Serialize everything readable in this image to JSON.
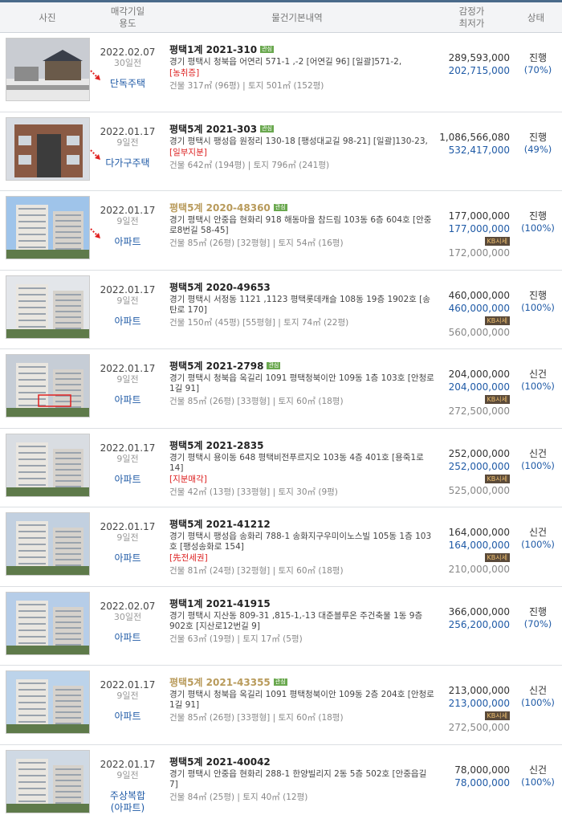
{
  "header": {
    "photo": "사진",
    "date_l1": "매각기일",
    "date_l2": "용도",
    "info": "물건기본내역",
    "price_l1": "감정가",
    "price_l2": "최저가",
    "status": "상태"
  },
  "rows": [
    {
      "date": "2022.02.07",
      "ago": "30일전",
      "usage": "단독주택",
      "usage2": "",
      "case": "평택1계 2021-310",
      "badge": "관심",
      "highlight": false,
      "addr": "경기 평택시 청북읍 어연리 571-1 ,-2 [어연길 96] [일괄]571-2,",
      "warn": "[농취증]",
      "area": "건물 317㎡ (96평)  |  토지 501㎡ (152평)",
      "appraisal": "289,593,000",
      "minimum": "202,715,000",
      "sise": "",
      "market": "",
      "status": "진행",
      "pct": "(70%)",
      "arrow": true
    },
    {
      "date": "2022.01.17",
      "ago": "9일전",
      "usage": "다가구주택",
      "usage2": "",
      "case": "평택5계 2021-303",
      "badge": "관심",
      "highlight": false,
      "addr": "경기 평택시 팽성읍 원정리 130-18 [팽성대교길 98-21] [일괄]130-23,",
      "warn": "[일부지분]",
      "area": "건물 642㎡ (194평)  |  토지 796㎡ (241평)",
      "appraisal": "1,086,566,080",
      "minimum": "532,417,000",
      "sise": "",
      "market": "",
      "status": "진행",
      "pct": "(49%)",
      "arrow": true
    },
    {
      "date": "2022.01.17",
      "ago": "9일전",
      "usage": "아파트",
      "usage2": "",
      "case": "평택5계 2020-48360",
      "badge": "관심",
      "highlight": true,
      "addr": "경기 평택시 안중읍 현화리 918 해동마을 참드림 103동 6층 604호 [안중로8번길 58-45]",
      "warn": "",
      "area": "건물 85㎡ (26평) [32평형]  |  토지 54㎡ (16평)",
      "appraisal": "177,000,000",
      "minimum": "177,000,000",
      "sise": "KB시세",
      "market": "172,000,000",
      "status": "진행",
      "pct": "(100%)",
      "arrow": true
    },
    {
      "date": "2022.01.17",
      "ago": "9일전",
      "usage": "아파트",
      "usage2": "",
      "case": "평택5계 2020-49653",
      "badge": "",
      "highlight": false,
      "addr": "경기 평택시 서정동 1121 ,1123 평택롯데캐슬 108동 19층 1902호 [송탄로 170]",
      "warn": "",
      "area": "건물 150㎡ (45평) [55평형]  |  토지 74㎡ (22평)",
      "appraisal": "460,000,000",
      "minimum": "460,000,000",
      "sise": "KB시세",
      "market": "560,000,000",
      "status": "진행",
      "pct": "(100%)",
      "arrow": false
    },
    {
      "date": "2022.01.17",
      "ago": "9일전",
      "usage": "아파트",
      "usage2": "",
      "case": "평택5계 2021-2798",
      "badge": "관심",
      "highlight": false,
      "addr": "경기 평택시 청북읍 옥길리 1091 평택청북이안 109동 1층 103호 [안청로1길 91]",
      "warn": "",
      "area": "건물 85㎡ (26평) [33평형]  |  토지 60㎡ (18평)",
      "appraisal": "204,000,000",
      "minimum": "204,000,000",
      "sise": "KB시세",
      "market": "272,500,000",
      "status": "신건",
      "pct": "(100%)",
      "arrow": false
    },
    {
      "date": "2022.01.17",
      "ago": "9일전",
      "usage": "아파트",
      "usage2": "",
      "case": "평택5계 2021-2835",
      "badge": "",
      "highlight": false,
      "addr": "경기 평택시 용이동 648 평택비전푸르지오 103동 4층 401호 [용죽1로 14]",
      "warn": "[지분매각]",
      "area": "건물 42㎡ (13평) [33평형]  |  토지 30㎡ (9평)",
      "appraisal": "252,000,000",
      "minimum": "252,000,000",
      "sise": "KB시세",
      "market": "525,000,000",
      "status": "신건",
      "pct": "(100%)",
      "arrow": false
    },
    {
      "date": "2022.01.17",
      "ago": "9일전",
      "usage": "아파트",
      "usage2": "",
      "case": "평택5계 2021-41212",
      "badge": "",
      "highlight": false,
      "addr": "경기 평택시 팽성읍 송화리 788-1 송화지구우미이노스빌 105동 1층 103호 [팽성송화로 154]",
      "warn": "[先전세권]",
      "area": "건물 81㎡ (24평) [32평형]  |  토지 60㎡ (18평)",
      "appraisal": "164,000,000",
      "minimum": "164,000,000",
      "sise": "KB시세",
      "market": "210,000,000",
      "status": "신건",
      "pct": "(100%)",
      "arrow": false
    },
    {
      "date": "2022.02.07",
      "ago": "30일전",
      "usage": "아파트",
      "usage2": "",
      "case": "평택1계 2021-41915",
      "badge": "",
      "highlight": false,
      "addr": "경기 평택시 지산동 809-31 ,815-1,-13 대준블루온 주건축물 1동 9층 902호 [지산로12번길 9]",
      "warn": "",
      "area": "건물 63㎡ (19평)  |  토지 17㎡ (5평)",
      "appraisal": "366,000,000",
      "minimum": "256,200,000",
      "sise": "",
      "market": "",
      "status": "진행",
      "pct": "(70%)",
      "arrow": false
    },
    {
      "date": "2022.01.17",
      "ago": "9일전",
      "usage": "아파트",
      "usage2": "",
      "case": "평택5계 2021-43355",
      "badge": "관심",
      "highlight": true,
      "addr": "경기 평택시 청북읍 옥길리 1091 평택청북이안 109동 2층 204호 [안청로1길 91]",
      "warn": "",
      "area": "건물 85㎡ (26평) [33평형]  |  토지 60㎡ (18평)",
      "appraisal": "213,000,000",
      "minimum": "213,000,000",
      "sise": "KB시세",
      "market": "272,500,000",
      "status": "신건",
      "pct": "(100%)",
      "arrow": false
    },
    {
      "date": "2022.01.17",
      "ago": "9일전",
      "usage": "주상복합",
      "usage2": "(아파트)",
      "case": "평택5계 2021-40042",
      "badge": "",
      "highlight": false,
      "addr": "경기 평택시 안중읍 현화리 288-1 한양빌리지 2동 5층 502호 [안중읍길 7]",
      "warn": "",
      "area": "건물 84㎡ (25평)  |  토지 40㎡ (12평)",
      "appraisal": "78,000,000",
      "minimum": "78,000,000",
      "sise": "",
      "market": "",
      "status": "신건",
      "pct": "(100%)",
      "arrow": false
    }
  ],
  "colors": {
    "accent": "#1f5aa6",
    "warn": "#dd2222",
    "highlight_case": "#b89a5a",
    "badge": "#6aa84f"
  }
}
